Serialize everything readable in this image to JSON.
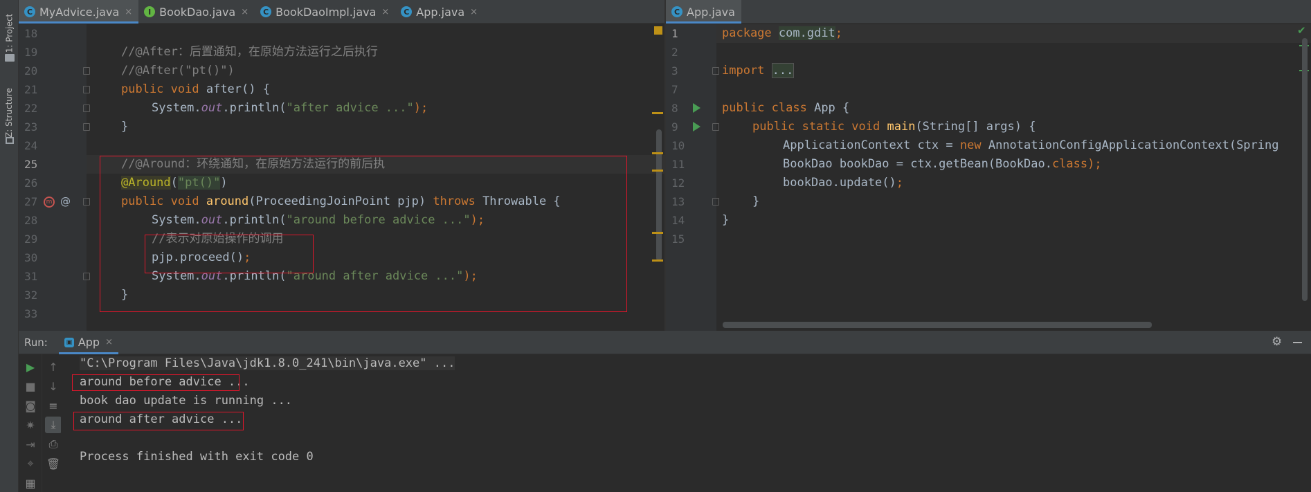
{
  "sidebar": {
    "project_tab": "1: Project",
    "structure_tab": "Z: Structure"
  },
  "left_tabs": [
    {
      "label": "MyAdvice.java",
      "icon": "class-icon",
      "close": "×"
    },
    {
      "label": "BookDao.java",
      "icon": "interface-icon",
      "close": "×"
    },
    {
      "label": "BookDaoImpl.java",
      "icon": "class-icon",
      "close": "×"
    },
    {
      "label": "App.java",
      "icon": "class-icon",
      "close": "×"
    }
  ],
  "right_tabs": [
    {
      "label": "App.java",
      "icon": "class-icon"
    }
  ],
  "left_editor": {
    "line_numbers": [
      "18",
      "19",
      "20",
      "21",
      "22",
      "23",
      "24",
      "25",
      "26",
      "27",
      "28",
      "29",
      "30",
      "31",
      "32",
      "33"
    ],
    "lines": {
      "l19": "//@After：后置通知，在原始方法运行之后执行",
      "l20": "//@After(\"pt()\")",
      "l21_kw": "public void",
      "l21_fn": "after",
      "l21_rest": "() {",
      "l22_a": "System.",
      "l22_b": "out",
      "l22_c": ".println(",
      "l22_str": "\"after advice ...\"",
      "l22_end": ");",
      "l23": "}",
      "l25": "//@Around：环绕通知，在原始方法运行的前后执",
      "l26_ann": "@Around",
      "l26_p1": "(",
      "l26_str": "\"pt()\"",
      "l26_p2": ")",
      "l27_kw": "public void",
      "l27_fn": "around",
      "l27_rest": "(ProceedingJoinPoint pjp)",
      "l27_throws": "throws",
      "l27_end": "Throwable {",
      "l28_a": "System.",
      "l28_b": "out",
      "l28_c": ".println(",
      "l28_str": "\"around before advice ...\"",
      "l28_end": ");",
      "l29": "//表示对原始操作的调用",
      "l30_a": "pjp.proceed()",
      "l30_end": ";",
      "l31_a": "System.",
      "l31_b": "out",
      "l31_c": ".println(",
      "l31_str": "\"around after advice ...\"",
      "l31_end": ");",
      "l32": "}"
    }
  },
  "right_editor": {
    "line_numbers": [
      "1",
      "2",
      "3",
      "7",
      "8",
      "9",
      "10",
      "11",
      "12",
      "13",
      "14",
      "15"
    ],
    "lines": {
      "r1_kw": "package",
      "r1_pkg": "com.gdit",
      "r1_end": ";",
      "r3_kw": "import",
      "r3_fold": "...",
      "r8_kw": "public class",
      "r8_rest": "App {",
      "r9_kw": "public static void",
      "r9_fn": "main",
      "r9_rest": "(String[] args) {",
      "r10_a": "ApplicationContext ctx = ",
      "r10_kw": "new",
      "r10_rest": "AnnotationConfigApplicationContext(Spring",
      "r11_a": "BookDao bookDao = ctx.getBean(BookDao.",
      "r11_kw": "class",
      "r11_end": ");",
      "r12_a": "bookDao.update()",
      "r12_end": ";",
      "r13": "}",
      "r14": "}"
    }
  },
  "run_panel": {
    "label": "Run:",
    "tab": "App",
    "tab_close": "×",
    "console": [
      "\"C:\\Program Files\\Java\\jdk1.8.0_241\\bin\\java.exe\" ...",
      "around before advice ...",
      "book dao update is running ...",
      "around after advice ...",
      "",
      "Process finished with exit code 0"
    ]
  },
  "colors": {
    "accent": "#4a88c7",
    "highlight_box": "#e0162b",
    "run_green": "#499c54"
  }
}
